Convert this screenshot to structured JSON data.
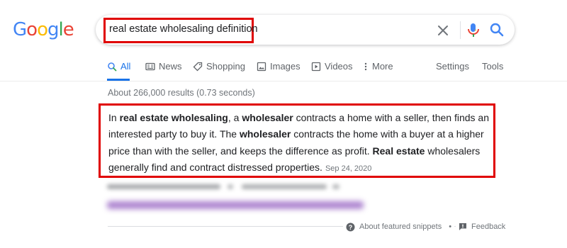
{
  "logo": {
    "letters": [
      "G",
      "o",
      "o",
      "g",
      "l",
      "e"
    ]
  },
  "search": {
    "query": "real estate wholesaling definition"
  },
  "icons": {
    "clear": "close-icon",
    "voice": "mic-icon",
    "search": "search-icon"
  },
  "tabs": [
    {
      "label": "All",
      "icon": "search-icon"
    },
    {
      "label": "News",
      "icon": "news-icon"
    },
    {
      "label": "Shopping",
      "icon": "tag-icon"
    },
    {
      "label": "Images",
      "icon": "image-icon"
    },
    {
      "label": "Videos",
      "icon": "play-icon"
    },
    {
      "label": "More",
      "icon": "more-vert-icon"
    }
  ],
  "tools": {
    "settings": "Settings",
    "tools": "Tools"
  },
  "results": {
    "stats": "About 266,000 results (0.73 seconds)"
  },
  "snippet": {
    "t1": "In ",
    "b1": "real estate wholesaling",
    "t2": ", a ",
    "b2": "wholesaler",
    "t3": " contracts a home with a seller, then finds an interested party to buy it. The ",
    "b3": "wholesaler",
    "t4": " contracts the home with a buyer at a higher price than with the seller, and keeps the difference as profit. ",
    "b4": "Real estate",
    "t5": " wholesalers generally find and contract distressed properties.",
    "date": "Sep 24, 2020"
  },
  "footer": {
    "about": "About featured snippets",
    "dot": "•",
    "feedback": "Feedback"
  },
  "colors": {
    "accent": "#1a73e8",
    "highlight": "#e00000",
    "blue": "#4285f4",
    "red": "#ea4335",
    "yellow": "#fbbc05",
    "green": "#34a853"
  }
}
